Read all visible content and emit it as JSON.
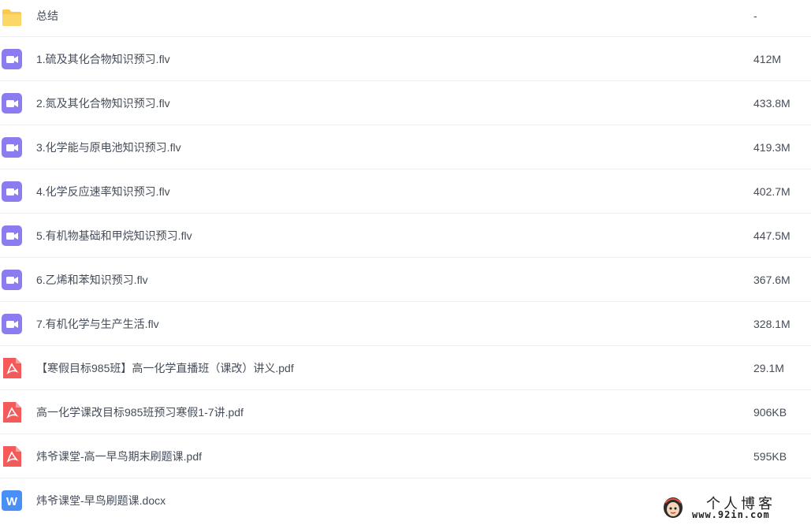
{
  "files": [
    {
      "name": "总结",
      "size": "-",
      "type": "folder",
      "icon": "folder-icon"
    },
    {
      "name": "1.硫及其化合物知识预习.flv",
      "size": "412M",
      "type": "video",
      "icon": "video-file-icon"
    },
    {
      "name": "2.氮及其化合物知识预习.flv",
      "size": "433.8M",
      "type": "video",
      "icon": "video-file-icon"
    },
    {
      "name": "3.化学能与原电池知识预习.flv",
      "size": "419.3M",
      "type": "video",
      "icon": "video-file-icon"
    },
    {
      "name": "4.化学反应速率知识预习.flv",
      "size": "402.7M",
      "type": "video",
      "icon": "video-file-icon"
    },
    {
      "name": "5.有机物基础和甲烷知识预习.flv",
      "size": "447.5M",
      "type": "video",
      "icon": "video-file-icon"
    },
    {
      "name": "6.乙烯和苯知识预习.flv",
      "size": "367.6M",
      "type": "video",
      "icon": "video-file-icon"
    },
    {
      "name": "7.有机化学与生产生活.flv",
      "size": "328.1M",
      "type": "video",
      "icon": "video-file-icon"
    },
    {
      "name": "【寒假目标985班】高一化学直播班（课改）讲义.pdf",
      "size": "29.1M",
      "type": "pdf",
      "icon": "pdf-file-icon"
    },
    {
      "name": "高一化学课改目标985班预习寒假1-7讲.pdf",
      "size": "906KB",
      "type": "pdf",
      "icon": "pdf-file-icon"
    },
    {
      "name": "炜爷课堂-高一早鸟期末刷题课.pdf",
      "size": "595KB",
      "type": "pdf",
      "icon": "pdf-file-icon"
    },
    {
      "name": "炜爷课堂-早鸟刷题课.docx",
      "size": "",
      "type": "word",
      "icon": "word-file-icon"
    }
  ],
  "colors": {
    "folder": "#fcc94a",
    "video": "#8b7cf0",
    "pdf": "#f45a5a",
    "word": "#4a8ff5"
  },
  "watermark": {
    "title": "个人博客",
    "url": "www.92in.com"
  }
}
